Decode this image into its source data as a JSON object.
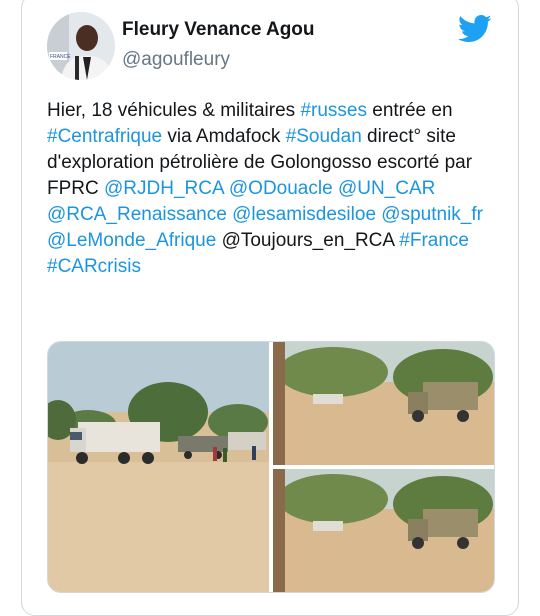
{
  "header": {
    "display_name": "Fleury Venance Agou",
    "handle": "@agoufleury"
  },
  "icons": {
    "brand": "twitter-bird-icon",
    "brand_color": "#1da1f2"
  },
  "colors": {
    "link": "#1b95e0",
    "text": "#14171a",
    "secondary": "#657786"
  },
  "tweet": {
    "segments": [
      {
        "text": "Hier, 18 véhicules & militaires ",
        "link": false
      },
      {
        "text": "#russes",
        "link": true
      },
      {
        "text": " entrée en ",
        "link": false
      },
      {
        "text": "#Centrafrique",
        "link": true
      },
      {
        "text": " via Amdafock ",
        "link": false
      },
      {
        "text": "#Soudan",
        "link": true
      },
      {
        "text": " direct° site d'exploration pétrolière de Golongosso escorté par FPRC ",
        "link": false
      },
      {
        "text": "@RJDH_RCA",
        "link": true
      },
      {
        "text": " ",
        "link": false
      },
      {
        "text": "@ODouacle",
        "link": true
      },
      {
        "text": " ",
        "link": false
      },
      {
        "text": "@UN_CAR",
        "link": true
      },
      {
        "text": " ",
        "link": false
      },
      {
        "text": "@RCA_Renaissance",
        "link": true
      },
      {
        "text": " ",
        "link": false
      },
      {
        "text": "@lesamisdesiloe",
        "link": true
      },
      {
        "text": " ",
        "link": false
      },
      {
        "text": "@sputnik_fr",
        "link": true
      },
      {
        "text": " ",
        "link": false
      },
      {
        "text": "@LeMonde_Afrique",
        "link": true
      },
      {
        "text": " @Toujours_en_RCA ",
        "link": false
      },
      {
        "text": "#France",
        "link": true
      },
      {
        "text": " ",
        "link": false
      },
      {
        "text": "#CARcrisis",
        "link": true
      }
    ]
  },
  "media": {
    "photos": [
      "photo-trucks-convoy",
      "photo-military-truck",
      "photo-military-truck"
    ],
    "avatar_badge": "FRANCE"
  }
}
